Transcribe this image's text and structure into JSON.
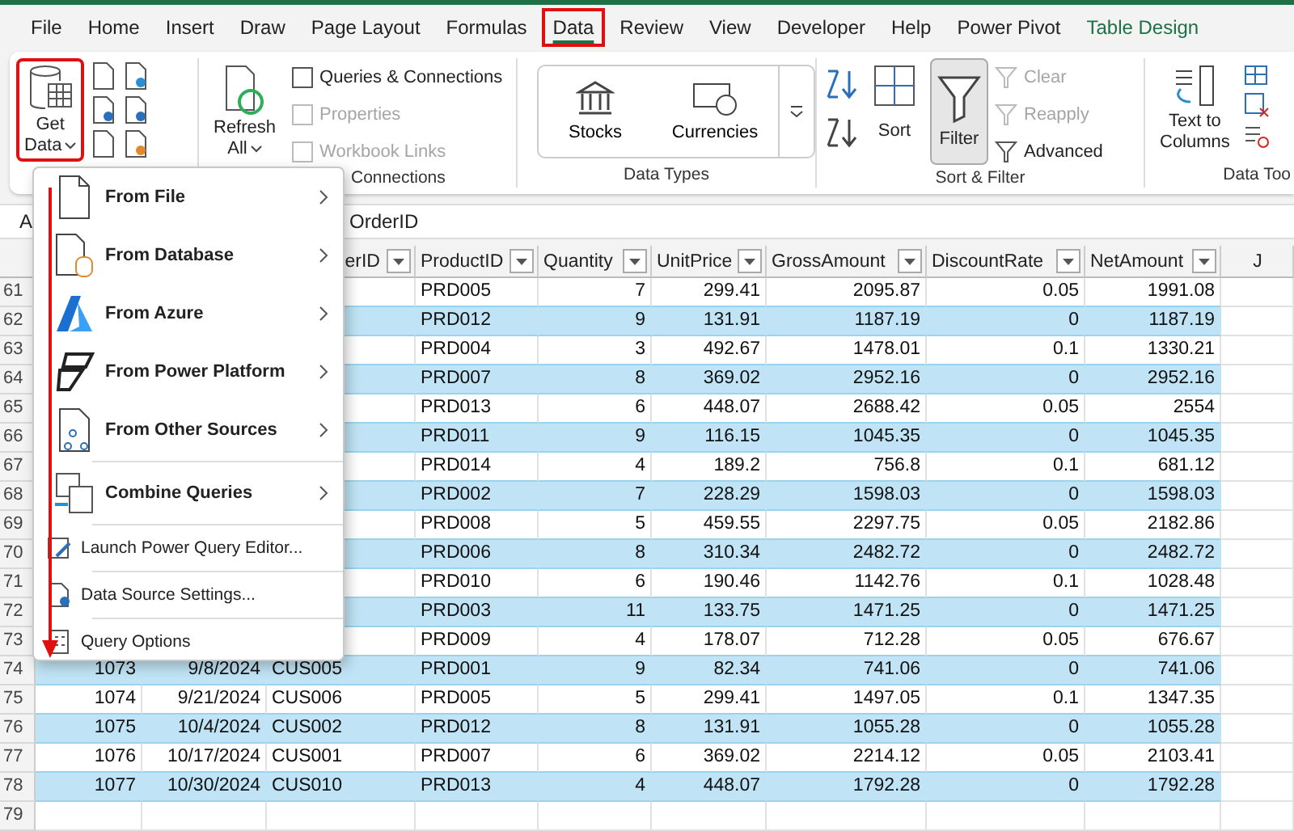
{
  "tabs": [
    {
      "label": "File",
      "selected": false,
      "highlighted": false,
      "contextual": false
    },
    {
      "label": "Home",
      "selected": false,
      "highlighted": false,
      "contextual": false
    },
    {
      "label": "Insert",
      "selected": false,
      "highlighted": false,
      "contextual": false
    },
    {
      "label": "Draw",
      "selected": false,
      "highlighted": false,
      "contextual": false
    },
    {
      "label": "Page Layout",
      "selected": false,
      "highlighted": false,
      "contextual": false
    },
    {
      "label": "Formulas",
      "selected": false,
      "highlighted": false,
      "contextual": false
    },
    {
      "label": "Data",
      "selected": true,
      "highlighted": true,
      "contextual": false
    },
    {
      "label": "Review",
      "selected": false,
      "highlighted": false,
      "contextual": false
    },
    {
      "label": "View",
      "selected": false,
      "highlighted": false,
      "contextual": false
    },
    {
      "label": "Developer",
      "selected": false,
      "highlighted": false,
      "contextual": false
    },
    {
      "label": "Help",
      "selected": false,
      "highlighted": false,
      "contextual": false
    },
    {
      "label": "Power Pivot",
      "selected": false,
      "highlighted": false,
      "contextual": false
    },
    {
      "label": "Table Design",
      "selected": false,
      "highlighted": false,
      "contextual": true
    }
  ],
  "ribbon": {
    "get_data": {
      "line_1": "Get",
      "line_2": "Data",
      "highlighted": true
    },
    "connections": {
      "refresh_1": "Refresh",
      "refresh_2": "All",
      "items": [
        {
          "label": "Queries & Connections",
          "disabled": false
        },
        {
          "label": "Properties",
          "disabled": true
        },
        {
          "label": "Workbook Links",
          "disabled": true
        }
      ],
      "group_label": "Connections"
    },
    "data_types": {
      "items": [
        "Stocks",
        "Currencies"
      ],
      "group_label": "Data Types"
    },
    "sort_filter": {
      "sort": "Sort",
      "filter": {
        "label": "Filter",
        "on": true
      },
      "items": [
        {
          "label": "Clear",
          "disabled": true
        },
        {
          "label": "Reapply",
          "disabled": true
        },
        {
          "label": "Advanced",
          "disabled": false
        }
      ],
      "group_label": "Sort & Filter"
    },
    "data_tools": {
      "line_1": "Text to",
      "line_2": "Columns",
      "group_label": "Data Too"
    }
  },
  "formula_bar": {
    "name_box": "A",
    "content": "OrderID"
  },
  "sheet": {
    "headers": [
      {
        "label": "erID",
        "filter": true
      },
      {
        "label": "ProductID",
        "filter": true
      },
      {
        "label": "Quantity",
        "filter": true
      },
      {
        "label": "UnitPrice",
        "filter": true
      },
      {
        "label": "GrossAmount",
        "filter": true
      },
      {
        "label": "DiscountRate",
        "filter": true
      },
      {
        "label": "NetAmount",
        "filter": true
      },
      {
        "label": "J",
        "filter": false
      }
    ],
    "rows": [
      {
        "number": "61",
        "cells": [
          "PRD005",
          "7",
          "299.41",
          "2095.87",
          "0.05",
          "1991.08"
        ]
      },
      {
        "number": "62",
        "cells": [
          "PRD012",
          "9",
          "131.91",
          "1187.19",
          "0",
          "1187.19"
        ]
      },
      {
        "number": "63",
        "cells": [
          "PRD004",
          "3",
          "492.67",
          "1478.01",
          "0.1",
          "1330.21"
        ]
      },
      {
        "number": "64",
        "cells": [
          "PRD007",
          "8",
          "369.02",
          "2952.16",
          "0",
          "2952.16"
        ]
      },
      {
        "number": "65",
        "cells": [
          "PRD013",
          "6",
          "448.07",
          "2688.42",
          "0.05",
          "2554"
        ]
      },
      {
        "number": "66",
        "cells": [
          "PRD011",
          "9",
          "116.15",
          "1045.35",
          "0",
          "1045.35"
        ]
      },
      {
        "number": "67",
        "cells": [
          "PRD014",
          "4",
          "189.2",
          "756.8",
          "0.1",
          "681.12"
        ]
      },
      {
        "number": "68",
        "cells": [
          "PRD002",
          "7",
          "228.29",
          "1598.03",
          "0",
          "1598.03"
        ]
      },
      {
        "number": "69",
        "cells": [
          "PRD008",
          "5",
          "459.55",
          "2297.75",
          "0.05",
          "2182.86"
        ]
      },
      {
        "number": "70",
        "cells": [
          "PRD006",
          "8",
          "310.34",
          "2482.72",
          "0",
          "2482.72"
        ]
      },
      {
        "number": "71",
        "cells": [
          "PRD010",
          "6",
          "190.46",
          "1142.76",
          "0.1",
          "1028.48"
        ]
      },
      {
        "number": "72",
        "cells": [
          "PRD003",
          "11",
          "133.75",
          "1471.25",
          "0",
          "1471.25"
        ]
      },
      {
        "number": "73",
        "cells": [
          "PRD009",
          "4",
          "178.07",
          "712.28",
          "0.05",
          "676.67"
        ]
      },
      {
        "number": "74",
        "cells": [
          "1073",
          "9/8/2024",
          "CUS005",
          "PRD001",
          "9",
          "82.34",
          "741.06",
          "0",
          "741.06"
        ]
      },
      {
        "number": "75",
        "cells": [
          "1074",
          "9/21/2024",
          "CUS006",
          "PRD005",
          "5",
          "299.41",
          "1497.05",
          "0.1",
          "1347.35"
        ]
      },
      {
        "number": "76",
        "cells": [
          "1075",
          "10/4/2024",
          "CUS002",
          "PRD012",
          "8",
          "131.91",
          "1055.28",
          "0",
          "1055.28"
        ]
      },
      {
        "number": "77",
        "cells": [
          "1076",
          "10/17/2024",
          "CUS001",
          "PRD007",
          "6",
          "369.02",
          "2214.12",
          "0.05",
          "2103.41"
        ]
      },
      {
        "number": "78",
        "cells": [
          "1077",
          "10/30/2024",
          "CUS010",
          "PRD013",
          "4",
          "448.07",
          "1792.28",
          "0",
          "1792.28"
        ]
      },
      {
        "number": "79"
      }
    ]
  },
  "menu": {
    "items": [
      {
        "kind": "large",
        "label": "From File",
        "submenu": true
      },
      {
        "kind": "large",
        "label": "From Database",
        "submenu": true
      },
      {
        "kind": "large",
        "label": "From Azure",
        "submenu": true
      },
      {
        "kind": "large",
        "label": "From Power Platform",
        "submenu": true
      },
      {
        "kind": "large",
        "label": "From Other Sources",
        "submenu": true
      },
      {
        "kind": "large",
        "label": "Combine Queries",
        "submenu": true
      },
      {
        "kind": "small",
        "label": "Launch Power Query Editor...",
        "submenu": false
      },
      {
        "kind": "small",
        "label": "Data Source Settings...",
        "submenu": false
      },
      {
        "kind": "small",
        "label": "Query Options",
        "submenu": false
      }
    ]
  }
}
